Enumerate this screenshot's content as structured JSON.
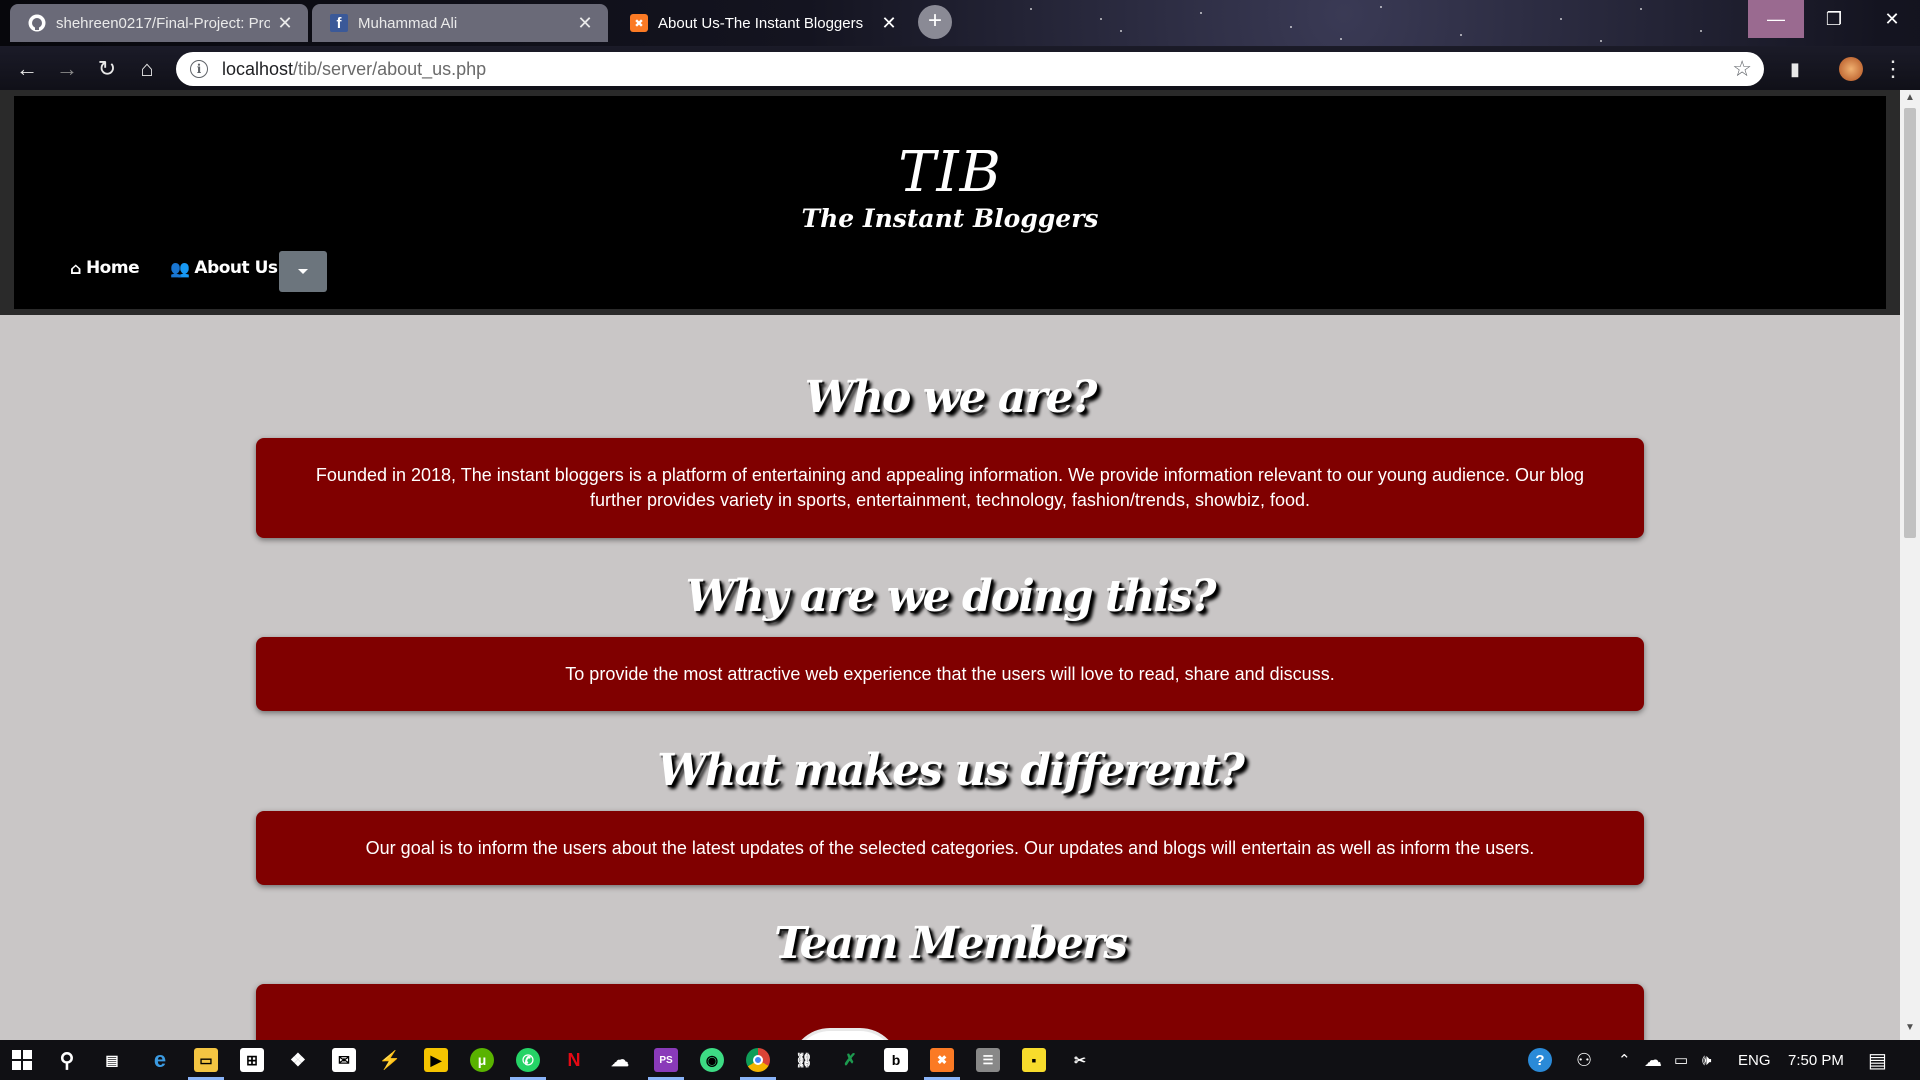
{
  "browser": {
    "tabs": [
      {
        "title": "shehreen0217/Final-Project: Pro",
        "icon": "github-icon",
        "active": false
      },
      {
        "title": "Muhammad Ali",
        "icon": "facebook-icon",
        "active": false
      },
      {
        "title": "About Us-The Instant Bloggers",
        "icon": "xampp-icon",
        "active": true
      }
    ],
    "new_tab": "+",
    "url_host": "localhost",
    "url_path": "/tib/server/about_us.php"
  },
  "site": {
    "logo": "TIB",
    "tagline": "The Instant Bloggers",
    "nav": {
      "home": "Home",
      "about": "About Us"
    }
  },
  "sections": [
    {
      "title": "Who we are?",
      "text": "Founded in 2018, The instant bloggers is a platform of entertaining and appealing information. We provide information relevant to our young audience. Our blog further provides variety in sports, entertainment, technology, fashion/trends, showbiz, food."
    },
    {
      "title": "Why are we doing this?",
      "text": "To provide the most attractive web experience that the users will love to read, share and discuss."
    },
    {
      "title": "What makes us different?",
      "text": "Our goal is to inform the users about the latest updates of the selected categories. Our updates and blogs will entertain as well as inform the users."
    },
    {
      "title": "Team Members",
      "text": ""
    }
  ],
  "taskbar": {
    "language": "ENG",
    "time": "7:50 PM",
    "apps": [
      "windows-start-icon",
      "search-icon",
      "task-view-icon",
      "edge-icon",
      "file-explorer-icon",
      "store-icon",
      "dropbox-icon",
      "mail-icon",
      "vscode-icon",
      "sublime-icon",
      "utorrent-icon",
      "whatsapp-icon",
      "netflix-icon",
      "soundcloud-icon",
      "phpstorm-icon",
      "android-studio-icon",
      "chrome-icon",
      "git-icon",
      "excel-icon",
      "bing-icon",
      "xampp-icon",
      "database-icon",
      "sticky-notes-icon",
      "snipping-icon"
    ]
  },
  "colors": {
    "card": "#800000",
    "page_bg": "#c9c6c6",
    "header_bg": "#000000"
  }
}
